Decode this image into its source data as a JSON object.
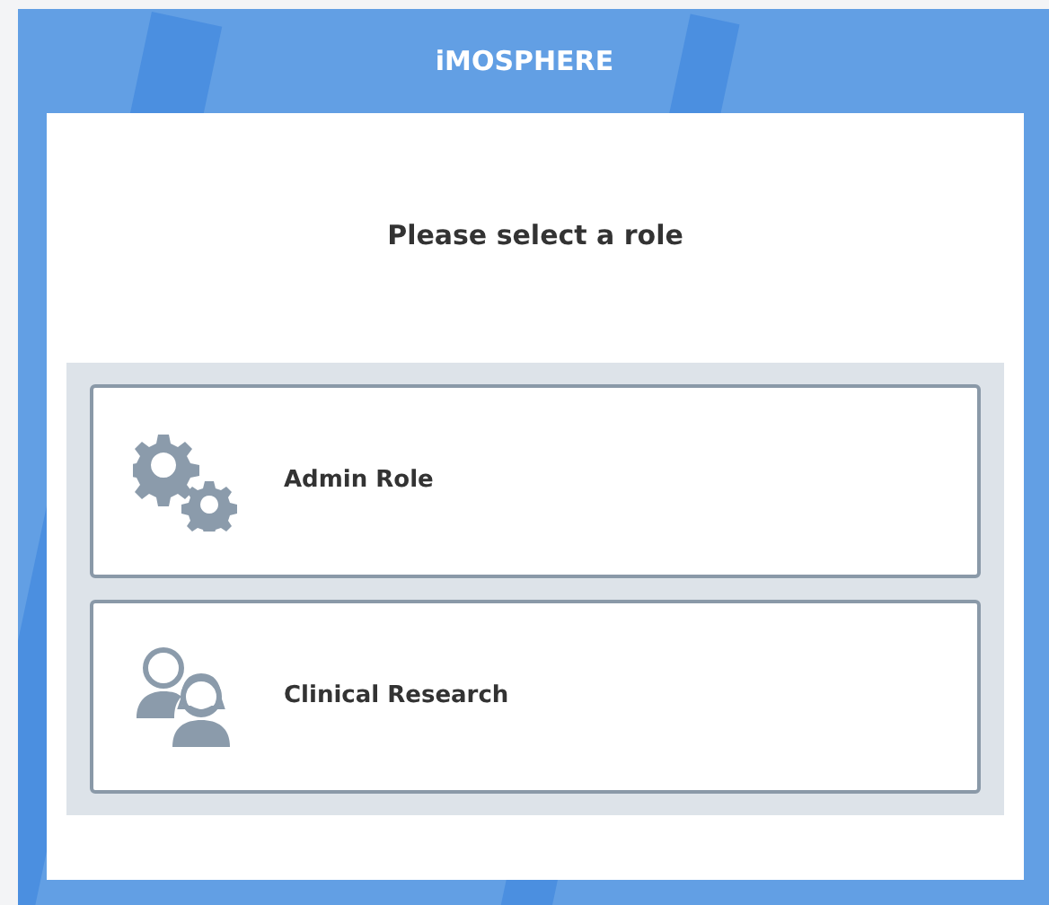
{
  "header": {
    "logo": "iMOSPHERE"
  },
  "dialog": {
    "title": "Please select a role",
    "roles": [
      {
        "label": "Admin Role",
        "kind": "gears"
      },
      {
        "label": "Clinical Research",
        "kind": "people"
      }
    ]
  }
}
